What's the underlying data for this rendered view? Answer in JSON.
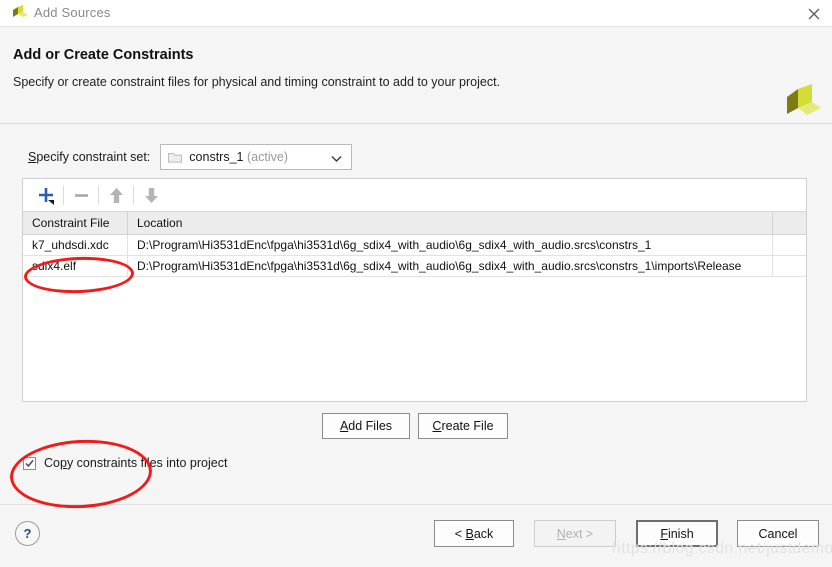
{
  "window": {
    "title": "Add Sources",
    "logo_icon": "vivado-logo-icon",
    "close_icon": "close-icon"
  },
  "header": {
    "title": "Add or Create Constraints",
    "subtitle": "Specify or create constraint files for physical and timing constraint to add to your project.",
    "logo_icon": "xilinx-logo-icon"
  },
  "constraint_set": {
    "label": "Specify constraint set:",
    "folder_icon": "folder-icon",
    "value": "constrs_1",
    "value_suffix": "(active)",
    "chevron_icon": "chevron-down-icon"
  },
  "toolbar": {
    "add_icon": "plus-icon",
    "remove_icon": "minus-icon",
    "move_up_icon": "arrow-up-icon",
    "move_down_icon": "arrow-down-icon"
  },
  "table": {
    "columns": [
      "Constraint File",
      "Location"
    ],
    "rows": [
      {
        "file": "k7_uhdsdi.xdc",
        "location": "D:\\Program\\Hi3531dEnc\\fpga\\hi3531d\\6g_sdix4_with_audio\\6g_sdix4_with_audio.srcs\\constrs_1"
      },
      {
        "file": "sdix4.elf",
        "location": "D:\\Program\\Hi3531dEnc\\fpga\\hi3531d\\6g_sdix4_with_audio\\6g_sdix4_with_audio.srcs\\constrs_1\\imports\\Release"
      }
    ]
  },
  "file_buttons": {
    "add_files": "Add Files",
    "add_files_accel": "A",
    "create_file": "Create File",
    "create_file_accel": "C"
  },
  "copy_option": {
    "checked": true,
    "label_before": "Co",
    "label_accel": "p",
    "label_after": "y constraints files into project",
    "check_icon": "checkmark-icon"
  },
  "footer": {
    "help_label": "?",
    "back": "< Back",
    "next": "Next >",
    "finish": "Finish",
    "cancel": "Cancel"
  },
  "watermark": "https://blog.csdn.net/justdemo",
  "colors": {
    "accent_blue": "#2a5db0",
    "annotation_red": "#f01b1b",
    "logo_olive": "#7d7b12",
    "logo_yellow": "#d4dc36",
    "background": "#f5f5f5"
  }
}
